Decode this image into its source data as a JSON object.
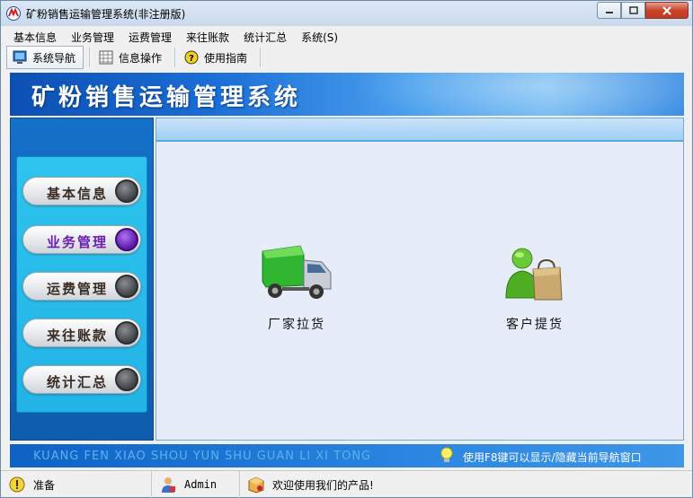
{
  "window": {
    "title": "矿粉销售运输管理系统(非注册版)"
  },
  "menu": {
    "items": [
      "基本信息",
      "业务管理",
      "运费管理",
      "来往账款",
      "统计汇总",
      "系统(S)"
    ]
  },
  "toolbar": {
    "items": [
      {
        "label": "系统导航",
        "icon": "monitor-icon",
        "active": true
      },
      {
        "label": "信息操作",
        "icon": "grid-icon",
        "active": false
      },
      {
        "label": "使用指南",
        "icon": "help-icon",
        "active": false
      }
    ]
  },
  "banner": {
    "title": "矿粉销售运输管理系统"
  },
  "sidebar": {
    "items": [
      {
        "label": "基本信息",
        "active": false
      },
      {
        "label": "业务管理",
        "active": true
      },
      {
        "label": "运费管理",
        "active": false
      },
      {
        "label": "来往账款",
        "active": false
      },
      {
        "label": "统计汇总",
        "active": false
      }
    ]
  },
  "main": {
    "functions": [
      {
        "label": "厂家拉货",
        "icon": "truck-icon"
      },
      {
        "label": "客户提货",
        "icon": "customer-bag-icon"
      }
    ]
  },
  "footer": {
    "pinyin": "KUANG FEN XIAO SHOU YUN SHU GUAN LI XI TONG",
    "tip": "使用F8键可以显示/隐藏当前导航窗口"
  },
  "status": {
    "state": "准备",
    "user": "Admin",
    "message": "欢迎使用我们的产品!"
  },
  "colors": {
    "banner": "#1a6ed6",
    "sidebar": "#1570c8",
    "sidebar_inner": "#2ec4ee",
    "active_item": "#6a1fb0",
    "main_bg": "#e6edf8"
  }
}
